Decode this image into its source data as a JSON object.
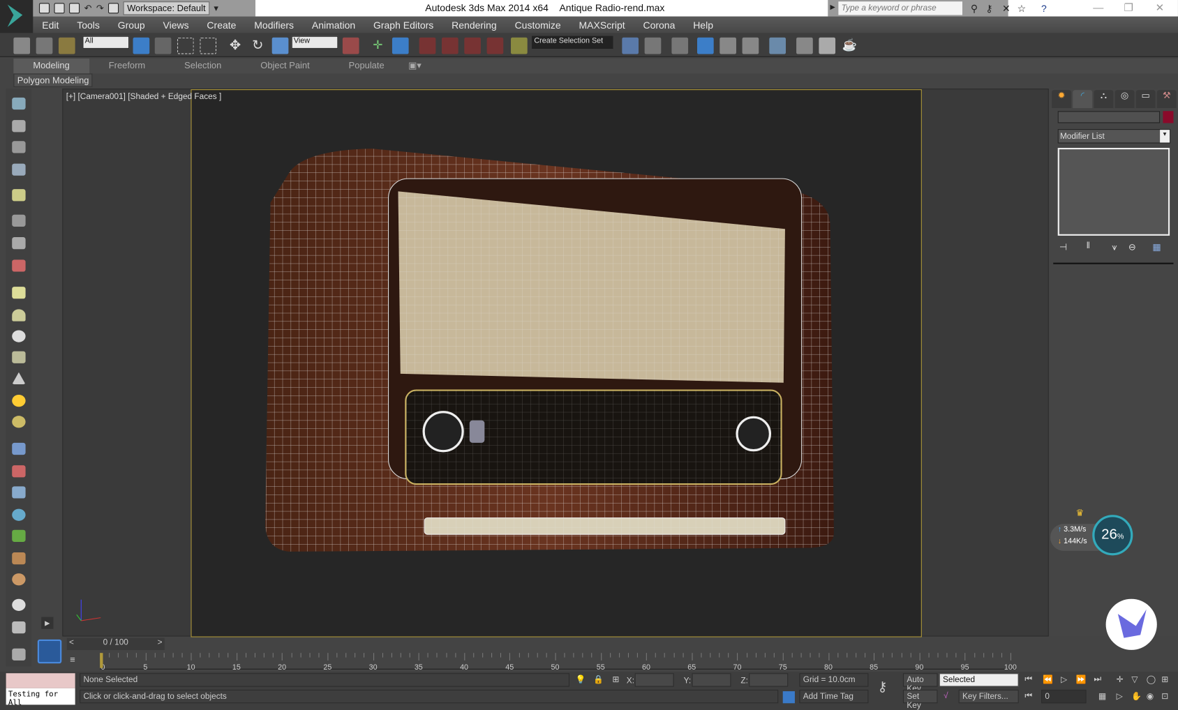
{
  "titlebar": {
    "app": "Autodesk 3ds Max  2014 x64",
    "file": "Antique Radio-rend.max",
    "workspace": "Workspace: Default",
    "search_placeholder": "Type a keyword or phrase"
  },
  "menu": [
    "Edit",
    "Tools",
    "Group",
    "Views",
    "Create",
    "Modifiers",
    "Animation",
    "Graph Editors",
    "Rendering",
    "Customize",
    "MAXScript",
    "Corona",
    "Help"
  ],
  "toolbar": {
    "filter": "All",
    "ref_coord": "View",
    "selection_set": "Create Selection Set"
  },
  "ribbon": {
    "tabs": [
      "Modeling",
      "Freeform",
      "Selection",
      "Object Paint",
      "Populate"
    ],
    "panel": "Polygon Modeling"
  },
  "viewport": {
    "label": "[+] [Camera001] [Shaded + Edged Faces ]"
  },
  "command_panel": {
    "modifier_list": "Modifier List",
    "color": "#8a0a2a"
  },
  "timeline": {
    "frame": "0 / 100",
    "ticks": [
      "0",
      "5",
      "10",
      "15",
      "20",
      "25",
      "30",
      "35",
      "40",
      "45",
      "50",
      "55",
      "60",
      "65",
      "70",
      "75",
      "80",
      "85",
      "90",
      "95",
      "100"
    ]
  },
  "status": {
    "selection": "None Selected",
    "prompt": "Click or click-and-drag to select objects",
    "x_label": "X:",
    "y_label": "Y:",
    "z_label": "Z:",
    "grid": "Grid = 10.0cm",
    "add_time_tag": "Add Time Tag",
    "auto_key": "Auto Key",
    "set_key": "Set Key",
    "key_mode": "Selected",
    "key_filters": "Key Filters...",
    "frame_value": "0",
    "maxscript": "Testing for All"
  },
  "net_widget": {
    "up": "3.3M/s",
    "down": "144K/s",
    "percent": "26",
    "percent_sign": "%"
  }
}
